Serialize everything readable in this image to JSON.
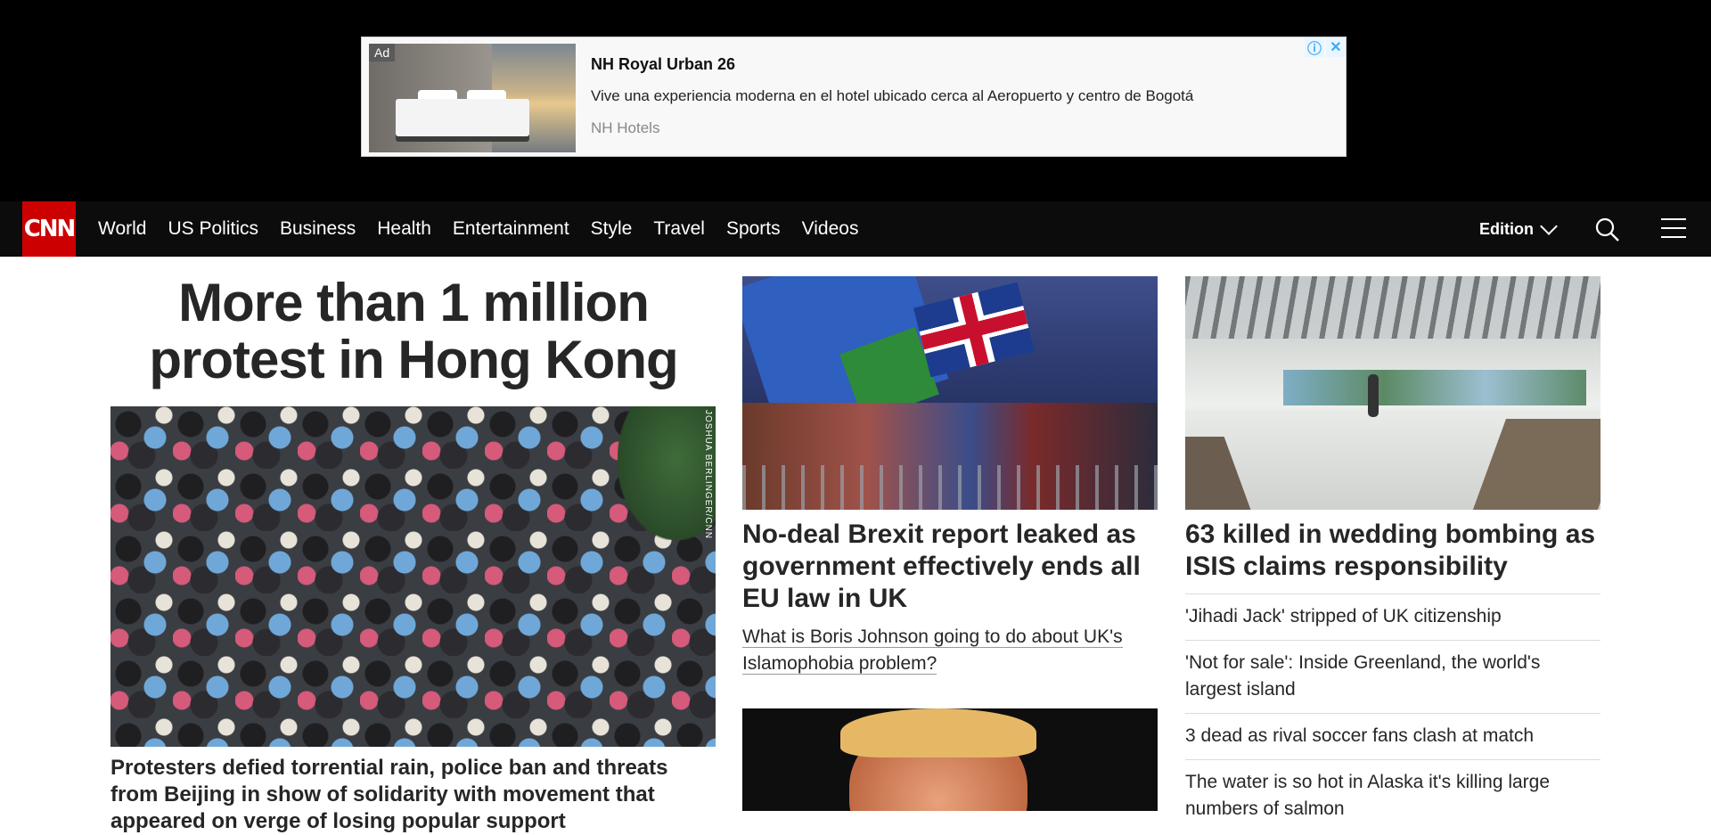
{
  "ad": {
    "tag": "Ad",
    "title": "NH Royal Urban 26",
    "description": "Vive una experiencia moderna en el hotel ubicado cerca al Aeropuerto y centro de Bogotá",
    "brand": "NH Hotels",
    "info_glyph": "ⓘ",
    "close_glyph": "✕"
  },
  "nav": {
    "logo": "CNN",
    "links": [
      "World",
      "US Politics",
      "Business",
      "Health",
      "Entertainment",
      "Style",
      "Travel",
      "Sports",
      "Videos"
    ],
    "edition_label": "Edition",
    "icons": [
      "search-icon",
      "menu-icon",
      "chevron-down-icon"
    ]
  },
  "main": {
    "hero_title": "More than 1 million protest in Hong Kong",
    "hero_credit": "JOSHUA BERLINGER/CNN",
    "hero_caption": "Protesters defied torrential rain, police ban and threats from Beijing in show of solidarity with movement that appeared on verge of losing popular support"
  },
  "middle": {
    "headline": "No-deal Brexit report leaked as government effectively ends all EU law in UK",
    "related_link": "What is Boris Johnson going to do about UK's Islamophobia problem?"
  },
  "right": {
    "headline": "63 killed in wedding bombing as ISIS claims responsibility",
    "items": [
      "'Jihadi Jack' stripped of UK citizenship",
      "'Not for sale': Inside Greenland, the world's largest island",
      "3 dead as rival soccer fans clash at match",
      "The water is so hot in Alaska it's killing large numbers of salmon"
    ]
  },
  "colors": {
    "brand_red": "#cc0000",
    "nav_bg": "#0c0c0c",
    "text": "#262626"
  }
}
